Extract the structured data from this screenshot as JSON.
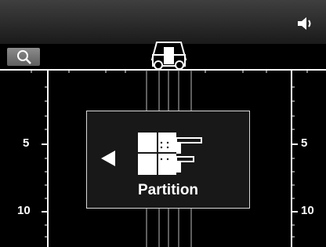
{
  "top_bar": {
    "speaker_icon": "speaker-icon"
  },
  "zoom_button": {
    "icon": "magnifier-icon"
  },
  "vehicle_icon": "vehicle-icon",
  "scale": {
    "left_labels": [
      "5",
      "10"
    ],
    "right_labels": [
      "5",
      "10"
    ]
  },
  "mode_panel": {
    "arrow_icon": "left-arrow-icon",
    "mode_icon": "partition-icon",
    "label": "Partition"
  },
  "colors": {
    "background": "#000000",
    "bar": "#2a2a2a",
    "lines": "#ffffff",
    "panel_border": "#d8d8d8"
  }
}
